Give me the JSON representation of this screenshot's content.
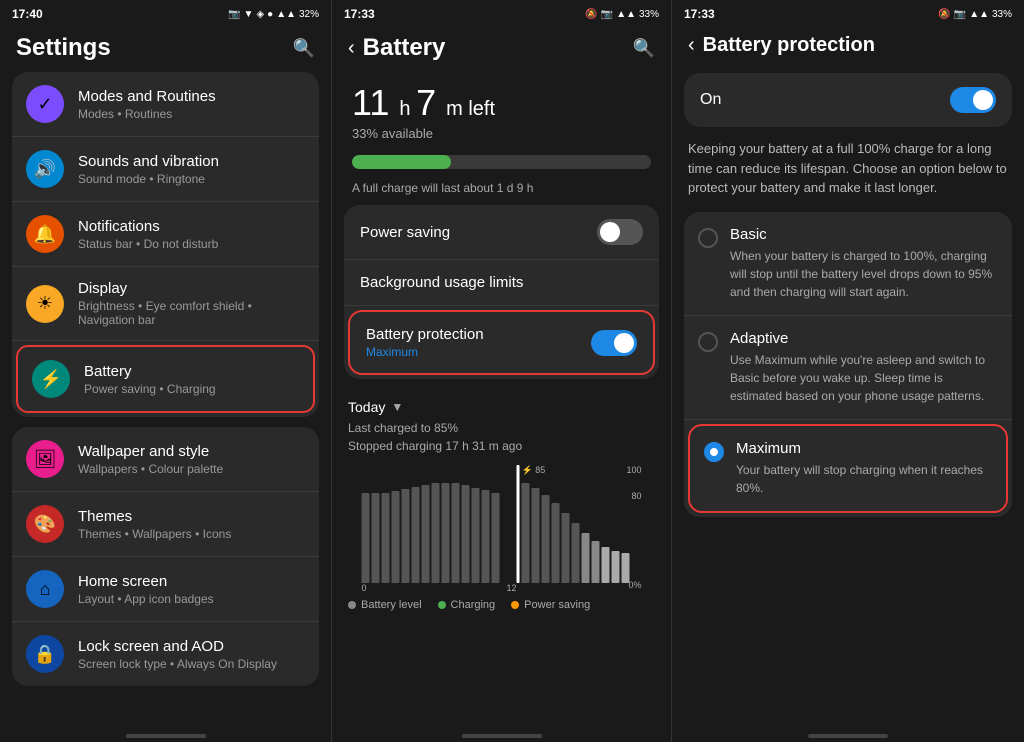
{
  "panel1": {
    "statusBar": {
      "time": "17:40",
      "battery": "32%",
      "icons": "📷 ▼ ◈ ●"
    },
    "title": "Settings",
    "items": [
      {
        "id": "modes",
        "icon": "✓",
        "iconBg": "icon-purple",
        "title": "Modes and Routines",
        "sub": "Modes • Routines"
      },
      {
        "id": "sounds",
        "icon": "🔊",
        "iconBg": "icon-blue-light",
        "title": "Sounds and vibration",
        "sub": "Sound mode • Ringtone"
      },
      {
        "id": "notifications",
        "icon": "🔔",
        "iconBg": "icon-orange",
        "title": "Notifications",
        "sub": "Status bar • Do not disturb"
      },
      {
        "id": "display",
        "icon": "☀",
        "iconBg": "icon-yellow",
        "title": "Display",
        "sub": "Brightness • Eye comfort shield • Navigation bar"
      },
      {
        "id": "battery",
        "icon": "⚡",
        "iconBg": "icon-teal",
        "title": "Battery",
        "sub": "Power saving • Charging",
        "highlighted": true
      },
      {
        "id": "wallpaper",
        "icon": "🖼",
        "iconBg": "icon-pink",
        "title": "Wallpaper and style",
        "sub": "Wallpapers • Colour palette"
      },
      {
        "id": "themes",
        "icon": "🎨",
        "iconBg": "icon-red-dark",
        "title": "Themes",
        "sub": "Themes • Wallpapers • Icons"
      },
      {
        "id": "homescreen",
        "icon": "⌂",
        "iconBg": "icon-blue",
        "title": "Home screen",
        "sub": "Layout • App icon badges"
      },
      {
        "id": "lockscreen",
        "icon": "🔒",
        "iconBg": "icon-blue2",
        "title": "Lock screen and AOD",
        "sub": "Screen lock type • Always On Display"
      }
    ]
  },
  "panel2": {
    "statusBar": {
      "time": "17:33",
      "battery": "33%",
      "icons": "🔕 📷 📶"
    },
    "title": "Battery",
    "batteryTime": {
      "hours": "11",
      "minutes": "7",
      "label": "left"
    },
    "batteryAvailable": "33% available",
    "batteryBarPercent": 33,
    "batteryChargeInfo": "A full charge will last about 1 d 9 h",
    "powerSaving": {
      "label": "Power saving",
      "toggleOn": false
    },
    "backgroundLimits": {
      "label": "Background usage limits"
    },
    "batteryProtection": {
      "label": "Battery protection",
      "sub": "Maximum",
      "toggleOn": true,
      "highlighted": true
    },
    "chart": {
      "headerTitle": "Today",
      "sub1": "Last charged to 85%",
      "sub2": "Stopped charging 17 h 31 m ago",
      "peakLabel": "85",
      "xLabels": [
        "0",
        "12"
      ],
      "yLabels": [
        "100",
        "80",
        "0%"
      ],
      "legendBatteryLevel": "Battery level",
      "legendCharging": "Charging",
      "legendPowerSaving": "Power saving"
    }
  },
  "panel3": {
    "statusBar": {
      "time": "17:33",
      "battery": "33%",
      "icons": "🔕 📷 📶"
    },
    "title": "Battery protection",
    "onToggle": {
      "label": "On",
      "on": true
    },
    "description": "Keeping your battery at a full 100% charge for a long time can reduce its lifespan. Choose an option below to protect your battery and make it last longer.",
    "options": [
      {
        "id": "basic",
        "title": "Basic",
        "desc": "When your battery is charged to 100%, charging will stop until the battery level drops down to 95% and then charging will start again.",
        "selected": false
      },
      {
        "id": "adaptive",
        "title": "Adaptive",
        "desc": "Use Maximum while you're asleep and switch to Basic before you wake up. Sleep time is estimated based on your phone usage patterns.",
        "selected": false
      },
      {
        "id": "maximum",
        "title": "Maximum",
        "desc": "Your battery will stop charging when it reaches 80%.",
        "selected": true,
        "highlighted": true
      }
    ]
  }
}
